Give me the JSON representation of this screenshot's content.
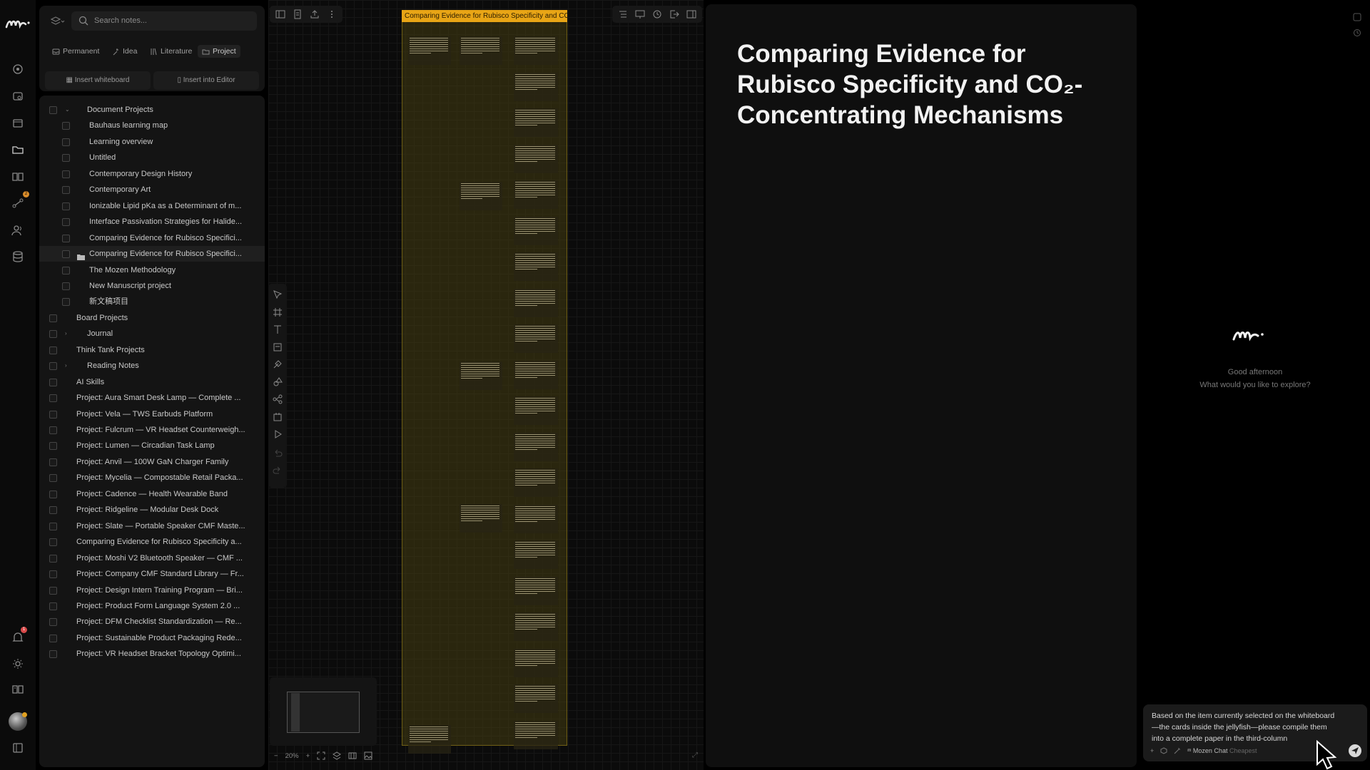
{
  "app": {
    "brand_colors": {
      "accent": "#e8a516",
      "frame": "#6d5d14",
      "badge": "#d98c2b"
    }
  },
  "rail": {
    "icons": [
      "mozen-logo-icon",
      "radar-icon",
      "layers-icon",
      "window-icon",
      "folder-icon",
      "book-icon",
      "workflow-icon",
      "users-icon",
      "database-icon",
      "bell-icon",
      "sun-icon",
      "manual-icon",
      "sidebar-toggle-icon"
    ],
    "workflow_badge": "2",
    "bell_badge": "1"
  },
  "notes": {
    "search_placeholder": "Search notes...",
    "type_tabs": [
      "Permanent",
      "Idea",
      "Literature",
      "Project"
    ],
    "active_tab": "Project",
    "insert_whiteboard": "Insert whiteboard",
    "insert_editor": "Insert into Editor"
  },
  "tree": [
    {
      "label": "Document Projects",
      "level": 1,
      "expandable": true,
      "expanded": true
    },
    {
      "label": "Bauhaus learning map",
      "level": 2
    },
    {
      "label": "Learning overview",
      "level": 2
    },
    {
      "label": "Untitled",
      "level": 2
    },
    {
      "label": "Contemporary Design History",
      "level": 2
    },
    {
      "label": "Contemporary Art",
      "level": 2
    },
    {
      "label": "Ionizable Lipid pKa as a Determinant of m...",
      "level": 2
    },
    {
      "label": "Interface Passivation Strategies for Halide...",
      "level": 2
    },
    {
      "label": "Comparing Evidence for Rubisco Specifici...",
      "level": 2
    },
    {
      "label": "Comparing Evidence for Rubisco Specifici...",
      "level": 2,
      "selected": true,
      "folder": true
    },
    {
      "label": "The Mozen Methodology",
      "level": 2
    },
    {
      "label": "New Manuscript project",
      "level": 2
    },
    {
      "label": "新文稿项目",
      "level": 2
    },
    {
      "label": "Board Projects",
      "level": 0
    },
    {
      "label": "Journal",
      "level": 1,
      "expandable": true
    },
    {
      "label": "Think Tank Projects",
      "level": 0
    },
    {
      "label": "Reading Notes",
      "level": 1,
      "expandable": true
    },
    {
      "label": "AI Skills",
      "level": 0
    },
    {
      "label": "Project: Aura Smart Desk Lamp — Complete ...",
      "level": 0
    },
    {
      "label": "Project: Vela — TWS Earbuds Platform",
      "level": 0
    },
    {
      "label": "Project: Fulcrum — VR Headset Counterweigh...",
      "level": 0
    },
    {
      "label": "Project: Lumen — Circadian Task Lamp",
      "level": 0
    },
    {
      "label": "Project: Anvil — 100W GaN Charger Family",
      "level": 0
    },
    {
      "label": "Project: Mycelia — Compostable Retail Packa...",
      "level": 0
    },
    {
      "label": "Project: Cadence — Health Wearable Band",
      "level": 0
    },
    {
      "label": "Project: Ridgeline — Modular Desk Dock",
      "level": 0
    },
    {
      "label": "Project: Slate — Portable Speaker CMF Maste...",
      "level": 0
    },
    {
      "label": "Comparing Evidence for Rubisco Specificity a...",
      "level": 0
    },
    {
      "label": "Project: Moshi V2 Bluetooth Speaker — CMF ...",
      "level": 0
    },
    {
      "label": "Project: Company CMF Standard Library — Fr...",
      "level": 0
    },
    {
      "label": "Project: Design Intern Training Program — Bri...",
      "level": 0
    },
    {
      "label": "Project: Product Form Language System 2.0 ...",
      "level": 0
    },
    {
      "label": "Project: DFM Checklist Standardization — Re...",
      "level": 0
    },
    {
      "label": "Project: Sustainable Product Packaging Rede...",
      "level": 0
    },
    {
      "label": "Project: VR Headset Bracket Topology Optimi...",
      "level": 0
    }
  ],
  "canvas": {
    "frame_title": "Comparing Evidence for Rubisco Specificity and CO",
    "zoom": "20%",
    "left_toolbar_icons": [
      "sidebar-icon",
      "page-icon",
      "share-icon",
      "more-icon"
    ],
    "right_toolbar_icons": [
      "outline-icon",
      "present-icon",
      "history-icon",
      "export-icon",
      "panel-icon"
    ],
    "tool_icons": [
      "select-icon",
      "frame-icon",
      "text-icon",
      "note-icon",
      "ai-tool-icon",
      "shapes-icon",
      "connector-icon",
      "template-icon",
      "play-icon",
      "undo-icon",
      "redo-icon"
    ]
  },
  "editor": {
    "title": "Comparing Evidence for Rubisco Specificity and CO₂-Concentrating Mechanisms"
  },
  "chat": {
    "greeting": "Good afternoon",
    "prompt": "What would you like to explore?",
    "input_text": "Based on the item currently selected on the whiteboard—the cards inside the jellyfish—please compile them into a complete paper in the third-column",
    "model_label": "Mozen Chat",
    "model_tier": "Cheapest"
  }
}
